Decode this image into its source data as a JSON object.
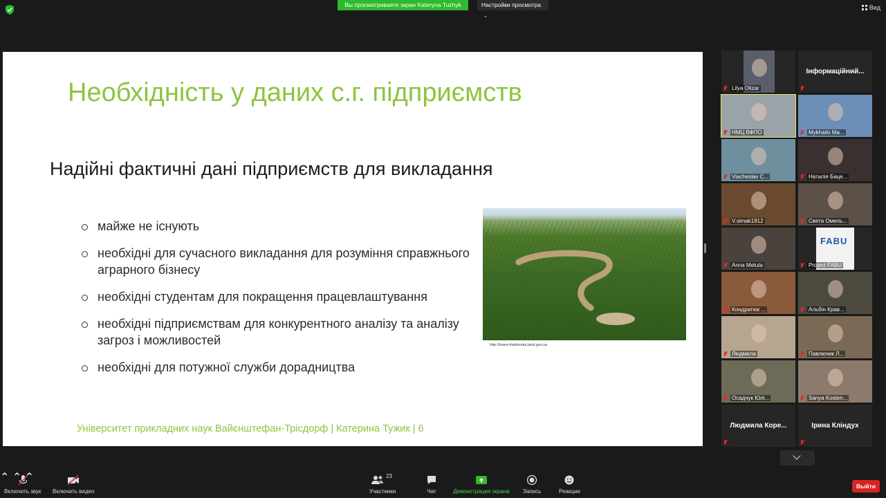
{
  "topbar": {
    "share_banner": "Вы просматриваете экран Kateryna Tuzhyk",
    "view_options": "Настройки просмотра",
    "view_button": "Вид"
  },
  "slide": {
    "title": "Необхідність у даних с.г. підприємств",
    "subtitle": "Надійні фактичні дані підприємств для викладання",
    "bullets": [
      "майже не існують",
      "необхідні для сучасного викладання для розуміння справжнього аграрного бізнесу",
      "необхідні студентам для покращення працевлаштування",
      "необхідні підприємствам для конкурентного аналізу та аналізу загроз і можливостей",
      "необхідні для потужної служби дорадництва"
    ],
    "image_caption": "http://ivano-frankivska.land.gov.ua",
    "footer": "Університет прикладних наук Вайєнштефан-Тріcдорф | Катерина Тужик | 6"
  },
  "participants": [
    {
      "name": "Lilya Olizar",
      "kind": "video",
      "bg": "#5a5e6a"
    },
    {
      "name": "Інформаційний...",
      "kind": "name"
    },
    {
      "name": "НМЦ ВФПО",
      "kind": "video",
      "bg": "#9aa3a8"
    },
    {
      "name": "Mykhailo Ma...",
      "kind": "video",
      "bg": "#6b8fb6"
    },
    {
      "name": "Viacheslav C...",
      "kind": "video",
      "bg": "#6f8f9e"
    },
    {
      "name": "Наталія Баце...",
      "kind": "video",
      "bg": "#3a3030"
    },
    {
      "name": "V.simak1912",
      "kind": "video",
      "bg": "#6a4a2e"
    },
    {
      "name": "Света Омель...",
      "kind": "video",
      "bg": "#5b5148"
    },
    {
      "name": "Anna Meluta",
      "kind": "video",
      "bg": "#4a423c"
    },
    {
      "name": "Project FABU",
      "kind": "logo",
      "bg": "#f2f2f2"
    },
    {
      "name": "Кондратюк ...",
      "kind": "video",
      "bg": "#8a5a3a"
    },
    {
      "name": "Альбін Крав...",
      "kind": "video",
      "bg": "#4d4a40"
    },
    {
      "name": "Людмила",
      "kind": "video",
      "bg": "#b6a690"
    },
    {
      "name": "Павлючик Л...",
      "kind": "video",
      "bg": "#7a6a55"
    },
    {
      "name": "Осадчук Юлі...",
      "kind": "video",
      "bg": "#6d6a58"
    },
    {
      "name": "Sanya Kosten...",
      "kind": "video",
      "bg": "#8c7a6c"
    },
    {
      "name": "Людмила Коре...",
      "kind": "name"
    },
    {
      "name": "Ірина Кліндух",
      "kind": "name"
    }
  ],
  "fabu_logo_text": "FABU",
  "toolbar": {
    "mute": "Включить звук",
    "video": "Включить видео",
    "participants": "Участники",
    "participants_count": "23",
    "chat": "Чат",
    "share": "Демонстрация экрана",
    "record": "Запись",
    "reactions": "Реакции",
    "leave": "Выйти"
  }
}
